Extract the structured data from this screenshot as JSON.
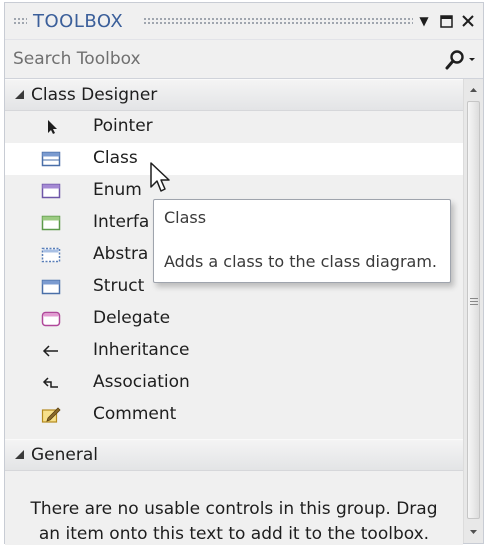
{
  "window": {
    "title": "TOOLBOX"
  },
  "titlebar_buttons": {
    "dropdown": "▼",
    "maximize": "□",
    "close": "✕"
  },
  "search": {
    "placeholder": "Search Toolbox",
    "value": "",
    "icon": "search-icon"
  },
  "groups": [
    {
      "label": "Class Designer",
      "expanded": true,
      "items": [
        {
          "label": "Pointer",
          "icon": "pointer-icon"
        },
        {
          "label": "Class",
          "icon": "class-icon",
          "selected": true
        },
        {
          "label": "Enum",
          "icon": "enum-icon"
        },
        {
          "label": "Interfa",
          "icon": "interface-icon"
        },
        {
          "label": "Abstra",
          "icon": "abstract-class-icon"
        },
        {
          "label": "Struct",
          "icon": "struct-icon"
        },
        {
          "label": "Delegate",
          "icon": "delegate-icon"
        },
        {
          "label": "Inheritance",
          "icon": "inheritance-icon"
        },
        {
          "label": "Association",
          "icon": "association-icon"
        },
        {
          "label": "Comment",
          "icon": "comment-icon"
        }
      ]
    },
    {
      "label": "General",
      "expanded": true,
      "empty_message_line1": "There are no usable controls in this group. Drag",
      "empty_message_line2": "an item onto this text to add it to the toolbox."
    }
  ],
  "tooltip": {
    "title": "Class",
    "description": "Adds a class to the class diagram."
  },
  "colors": {
    "title_text": "#3b5f9a",
    "panel_background": "#f0f0f0",
    "selected_row": "#ffffff"
  }
}
